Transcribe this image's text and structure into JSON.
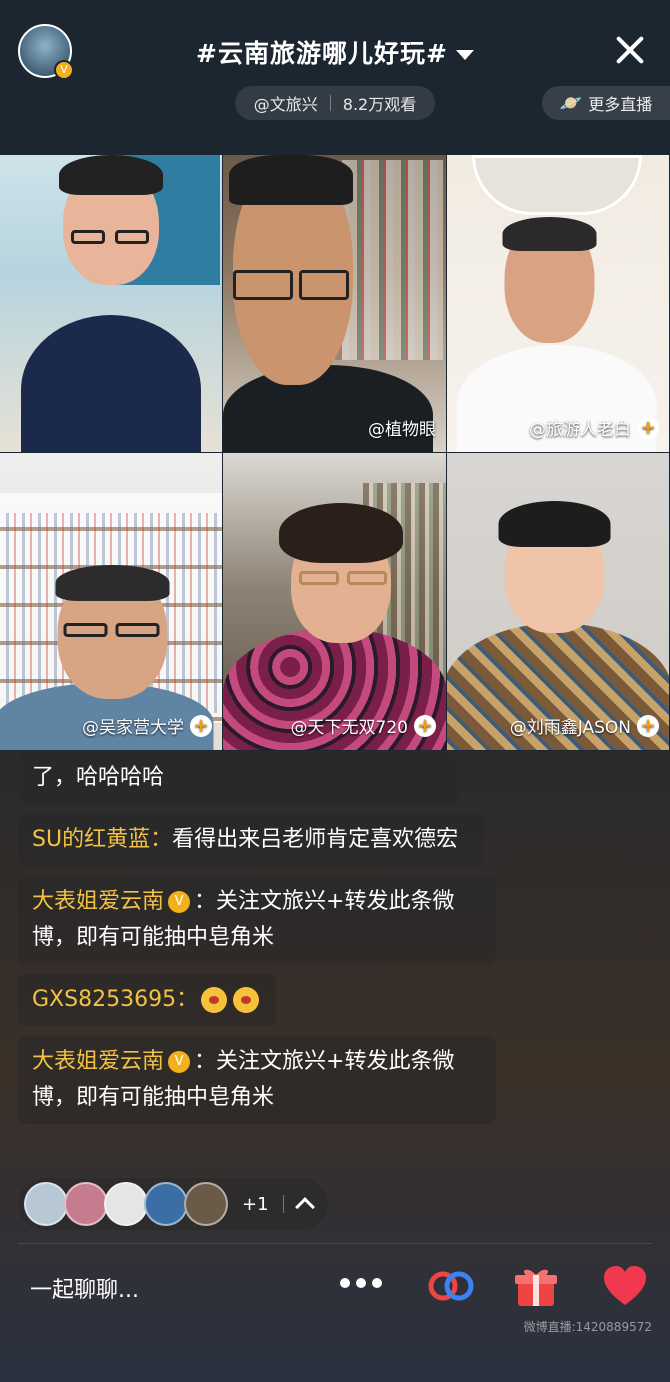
{
  "header": {
    "title": "#云南旅游哪儿好玩#",
    "host": "@文旅兴",
    "views": "8.2万观看",
    "more_live": "更多直播"
  },
  "grid": [
    {
      "label": "",
      "plus": false
    },
    {
      "label": "@植物眼",
      "plus": false
    },
    {
      "label": "@旅游人老白",
      "plus": true
    },
    {
      "label": "@吴家营大学",
      "plus": true
    },
    {
      "label": "@天下无双720",
      "plus": true
    },
    {
      "label": "@刘雨鑫JASON",
      "plus": true
    }
  ],
  "comments": [
    {
      "user": "",
      "text": "了，哈哈哈哈"
    },
    {
      "user": "SU的红黄蓝：",
      "text": "看得出来吕老师肯定喜欢德宏"
    },
    {
      "user": "大表姐爱云南",
      "verified": true,
      "text": "：关注文旅兴+转发此条微博，即有可能抽中皂角米"
    },
    {
      "user": "GXS8253695：",
      "text": ""
    },
    {
      "user": "大表姐爱云南",
      "verified": true,
      "text": "：关注文旅兴+转发此条微博，即有可能抽中皂角米"
    }
  ],
  "viewers": {
    "extra_count": "+1"
  },
  "bottom": {
    "chat_placeholder": "一起聊聊...",
    "watermark": "微博直播:1420889572"
  },
  "colors": {
    "username": "#f3c244",
    "heart": "#f0384e",
    "gift": "#ef4444",
    "share_left": "#ef4444",
    "share_right": "#3b82f6"
  }
}
